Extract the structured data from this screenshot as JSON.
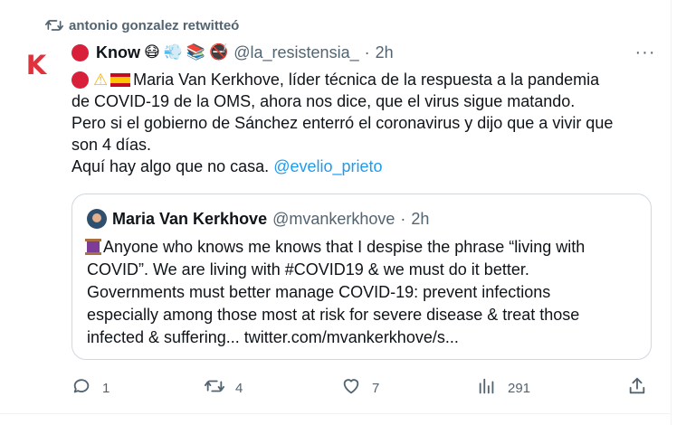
{
  "retweet_header": {
    "text": "antonio gonzalez retwitteó"
  },
  "author": {
    "name": "Know",
    "handle": "@la_resistensia_",
    "time": "2h",
    "avatar_letter": "K",
    "emojis": [
      "😷",
      "💨",
      "📚",
      "🚭"
    ]
  },
  "tweet": {
    "line1": "Maria Van Kerkhove, líder técnica de la respuesta a la pandemia",
    "line2": "de COVID-19 de la OMS, ahora nos dice, que el virus sigue matando.",
    "line3": "Pero si el gobierno de Sánchez enterró el coronavirus y dijo que a vivir que",
    "line4": "son 4 días.",
    "line5": "Aquí hay algo que no casa.",
    "mention": "@evelio_prieto"
  },
  "quote": {
    "name": "Maria Van Kerkhove",
    "handle": "@mvankerkhove",
    "time": "2h",
    "line1": "Anyone who knows me knows that I despise the phrase “living with",
    "line2": "COVID”.  We are living with #COVID19 & we must do it better.",
    "line3": "Governments must better manage COVID-19: prevent infections",
    "line4": "especially among those most at risk for severe disease & treat those",
    "line5": "infected & suffering... twitter.com/mvankerkhove/s..."
  },
  "actions": {
    "replies": "1",
    "retweets": "4",
    "likes": "7",
    "views": "291"
  },
  "colors": {
    "accent": "#1d9bf0",
    "muted": "#536471",
    "text": "#0f1419",
    "avatar": "#e0323c"
  }
}
